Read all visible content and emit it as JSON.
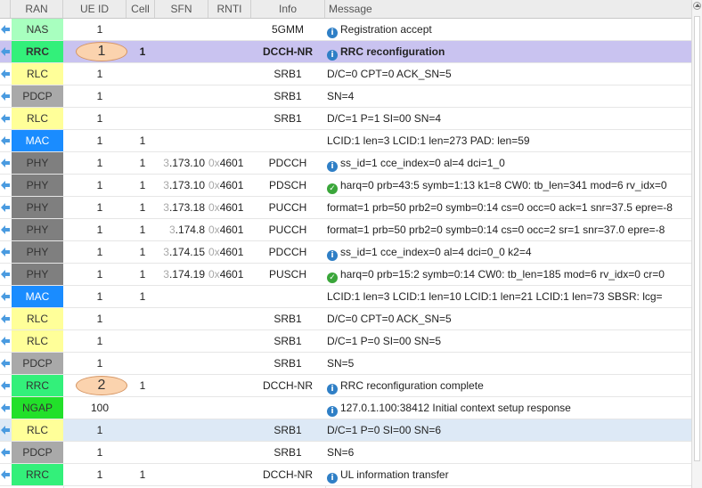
{
  "headers": {
    "ran": "RAN",
    "ue_id": "UE ID",
    "cell": "Cell",
    "sfn": "SFN",
    "rnti": "RNTI",
    "info": "Info",
    "message": "Message"
  },
  "callouts": [
    {
      "label": "1",
      "row": 1
    },
    {
      "label": "2",
      "row": 16
    }
  ],
  "colors": {
    "NAS": "#a8ffbf",
    "RRC": "#33f07a",
    "RLC": "#ffff99",
    "PDCP": "#a9a9a9",
    "MAC": "#1a8cff",
    "PHY": "#7f7f7f",
    "NGAP": "#22e02a",
    "selected_row": "#c9c3f0",
    "hover_row": "#dde9f6",
    "callout": "#fbd3ae"
  },
  "rows": [
    {
      "ran": "NAS",
      "ue": "1",
      "cell": "",
      "sfn_a": "",
      "sfn_b": "",
      "rnti_a": "",
      "rnti_b": "",
      "info": "5GMM",
      "icon": "info",
      "msg": "Registration accept"
    },
    {
      "ran": "RRC",
      "ue": "",
      "cell": "1",
      "sfn_a": "",
      "sfn_b": "",
      "rnti_a": "",
      "rnti_b": "",
      "info": "DCCH-NR",
      "icon": "info",
      "msg": "RRC reconfiguration",
      "state": "sel"
    },
    {
      "ran": "RLC",
      "ue": "1",
      "cell": "",
      "sfn_a": "",
      "sfn_b": "",
      "rnti_a": "",
      "rnti_b": "",
      "info": "SRB1",
      "icon": "",
      "msg": "D/C=0 CPT=0 ACK_SN=5"
    },
    {
      "ran": "PDCP",
      "ue": "1",
      "cell": "",
      "sfn_a": "",
      "sfn_b": "",
      "rnti_a": "",
      "rnti_b": "",
      "info": "SRB1",
      "icon": "",
      "msg": "SN=4"
    },
    {
      "ran": "RLC",
      "ue": "1",
      "cell": "",
      "sfn_a": "",
      "sfn_b": "",
      "rnti_a": "",
      "rnti_b": "",
      "info": "SRB1",
      "icon": "",
      "msg": "D/C=1 P=1 SI=00 SN=4"
    },
    {
      "ran": "MAC",
      "ue": "1",
      "cell": "1",
      "sfn_a": "",
      "sfn_b": "",
      "rnti_a": "",
      "rnti_b": "",
      "info": "",
      "icon": "",
      "msg": "LCID:1 len=3 LCID:1 len=273 PAD: len=59"
    },
    {
      "ran": "PHY",
      "ue": "1",
      "cell": "1",
      "sfn_a": "3",
      "sfn_b": ".173.10",
      "rnti_a": "0x",
      "rnti_b": "4601",
      "info": "PDCCH",
      "icon": "info",
      "msg": "ss_id=1 cce_index=0 al=4 dci=1_0"
    },
    {
      "ran": "PHY",
      "ue": "1",
      "cell": "1",
      "sfn_a": "3",
      "sfn_b": ".173.10",
      "rnti_a": "0x",
      "rnti_b": "4601",
      "info": "PDSCH",
      "icon": "ok",
      "msg": "harq=0 prb=43:5 symb=1:13 k1=8 CW0: tb_len=341 mod=6 rv_idx=0"
    },
    {
      "ran": "PHY",
      "ue": "1",
      "cell": "1",
      "sfn_a": "3",
      "sfn_b": ".173.18",
      "rnti_a": "0x",
      "rnti_b": "4601",
      "info": "PUCCH",
      "icon": "",
      "msg": "format=1 prb=50 prb2=0 symb=0:14 cs=0 occ=0 ack=1 snr=37.5 epre=-8"
    },
    {
      "ran": "PHY",
      "ue": "1",
      "cell": "1",
      "sfn_a": "3",
      "sfn_b": ".174.8",
      "rnti_a": "0x",
      "rnti_b": "4601",
      "info": "PUCCH",
      "icon": "",
      "msg": "format=1 prb=50 prb2=0 symb=0:14 cs=0 occ=2 sr=1 snr=37.0 epre=-8"
    },
    {
      "ran": "PHY",
      "ue": "1",
      "cell": "1",
      "sfn_a": "3",
      "sfn_b": ".174.15",
      "rnti_a": "0x",
      "rnti_b": "4601",
      "info": "PDCCH",
      "icon": "info",
      "msg": "ss_id=1 cce_index=0 al=4 dci=0_0 k2=4"
    },
    {
      "ran": "PHY",
      "ue": "1",
      "cell": "1",
      "sfn_a": "3",
      "sfn_b": ".174.19",
      "rnti_a": "0x",
      "rnti_b": "4601",
      "info": "PUSCH",
      "icon": "ok",
      "msg": "harq=0 prb=15:2 symb=0:14 CW0: tb_len=185 mod=6 rv_idx=0 cr=0"
    },
    {
      "ran": "MAC",
      "ue": "1",
      "cell": "1",
      "sfn_a": "",
      "sfn_b": "",
      "rnti_a": "",
      "rnti_b": "",
      "info": "",
      "icon": "",
      "msg": "LCID:1 len=3 LCID:1 len=10 LCID:1 len=21 LCID:1 len=73 SBSR: lcg="
    },
    {
      "ran": "RLC",
      "ue": "1",
      "cell": "",
      "sfn_a": "",
      "sfn_b": "",
      "rnti_a": "",
      "rnti_b": "",
      "info": "SRB1",
      "icon": "",
      "msg": "D/C=0 CPT=0 ACK_SN=5"
    },
    {
      "ran": "RLC",
      "ue": "1",
      "cell": "",
      "sfn_a": "",
      "sfn_b": "",
      "rnti_a": "",
      "rnti_b": "",
      "info": "SRB1",
      "icon": "",
      "msg": "D/C=1 P=0 SI=00 SN=5"
    },
    {
      "ran": "PDCP",
      "ue": "1",
      "cell": "",
      "sfn_a": "",
      "sfn_b": "",
      "rnti_a": "",
      "rnti_b": "",
      "info": "SRB1",
      "icon": "",
      "msg": "SN=5"
    },
    {
      "ran": "RRC",
      "ue": "",
      "cell": "1",
      "sfn_a": "",
      "sfn_b": "",
      "rnti_a": "",
      "rnti_b": "",
      "info": "DCCH-NR",
      "icon": "info",
      "msg": "RRC reconfiguration complete"
    },
    {
      "ran": "NGAP",
      "ue": "100",
      "cell": "",
      "sfn_a": "",
      "sfn_b": "",
      "rnti_a": "",
      "rnti_b": "",
      "info": "",
      "icon": "info",
      "msg": "127.0.1.100:38412 Initial context setup response"
    },
    {
      "ran": "RLC",
      "ue": "1",
      "cell": "",
      "sfn_a": "",
      "sfn_b": "",
      "rnti_a": "",
      "rnti_b": "",
      "info": "SRB1",
      "icon": "",
      "msg": "D/C=1 P=0 SI=00 SN=6",
      "state": "hl"
    },
    {
      "ran": "PDCP",
      "ue": "1",
      "cell": "",
      "sfn_a": "",
      "sfn_b": "",
      "rnti_a": "",
      "rnti_b": "",
      "info": "SRB1",
      "icon": "",
      "msg": "SN=6"
    },
    {
      "ran": "RRC",
      "ue": "1",
      "cell": "1",
      "sfn_a": "",
      "sfn_b": "",
      "rnti_a": "",
      "rnti_b": "",
      "info": "DCCH-NR",
      "icon": "info",
      "msg": "UL information transfer"
    }
  ]
}
